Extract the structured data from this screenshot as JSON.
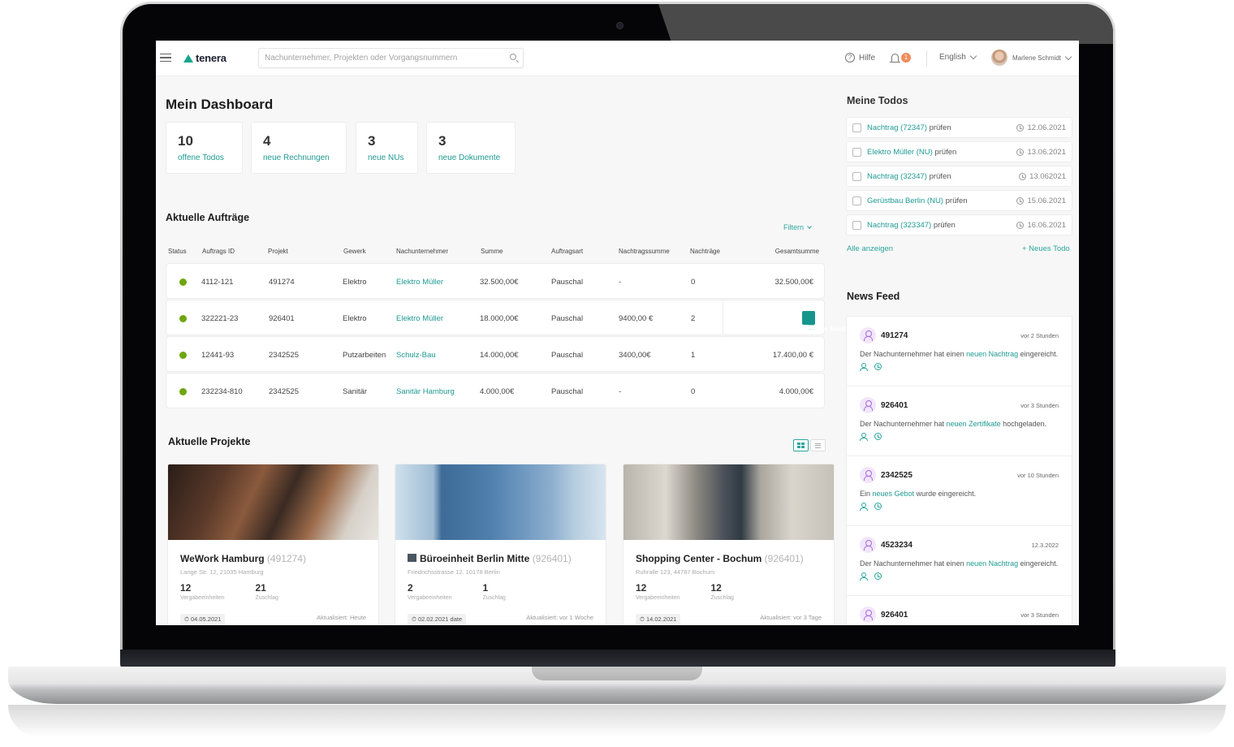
{
  "app": {
    "brand": "tenera",
    "accent_color": "#1f9a93",
    "status_color": "#6fa50f"
  },
  "topbar": {
    "search_placeholder": "Nachunternehmer, Projekten oder Vorgangsnummern",
    "help_label": "Hilfe",
    "notification_count": "1",
    "language": "English",
    "user_name": "Marlene Schmidt",
    "icons": [
      "menu-icon",
      "search-icon",
      "help-icon",
      "bell-icon",
      "chevron-down-icon",
      "avatar"
    ]
  },
  "dashboard": {
    "title": "Mein Dashboard",
    "stats": [
      {
        "value": "10",
        "label": "offene Todos"
      },
      {
        "value": "4",
        "label": "neue Rechnungen"
      },
      {
        "value": "3",
        "label": "neue NUs"
      },
      {
        "value": "3",
        "label": "neue Dokumente"
      }
    ]
  },
  "orders": {
    "title": "Aktuelle Aufträge",
    "filter_label": "Filtern",
    "columns": [
      "Status",
      "Auftrags ID",
      "Projekt",
      "Gewerk",
      "Nachunternehmer",
      "Summe",
      "Auftragsart",
      "Nachtragssumme",
      "Nachträge",
      "Gesamtsumme"
    ],
    "rows": [
      {
        "status": "active",
        "id": "4112-121",
        "projekt": "491274",
        "gewerk": "Elektro",
        "nu": "Elektro Müller",
        "summe": "32.500,00€",
        "art": "Pauschal",
        "nachtragssumme": "-",
        "nachtraege": "0",
        "gesamt": "32.500,00€"
      },
      {
        "status": "active",
        "id": "322221-23",
        "projekt": "926401",
        "gewerk": "Elektro",
        "nu": "Elektro Müller",
        "summe": "18.000,00€",
        "art": "Pauschal",
        "nachtragssumme": "9400,00 €",
        "nachtraege": "2",
        "gesamt": "",
        "action": "Neuer Nachtrag"
      },
      {
        "status": "active",
        "id": "12441-93",
        "projekt": "2342525",
        "gewerk": "Putzarbeiten",
        "nu": "Schulz-Bau",
        "summe": "14.000,00€",
        "art": "Pauschal",
        "nachtragssumme": "3400,00€",
        "nachtraege": "1",
        "gesamt": "17.400,00 €"
      },
      {
        "status": "active",
        "id": "232234-810",
        "projekt": "2342525",
        "gewerk": "Sanitär",
        "nu": "Sanitär Hamburg",
        "summe": "4.000,00€",
        "art": "Pauschal",
        "nachtragssumme": "-",
        "nachtraege": "0",
        "gesamt": "4.000,00€"
      }
    ]
  },
  "projects": {
    "title": "Aktuelle Projekte",
    "view_mode": "grid",
    "items": [
      {
        "name": "WeWork Hamburg",
        "id": "(491274)",
        "address": "Lange Str. 12, 21035 Hamburg",
        "vergabe": "12",
        "vergabe_label": "Vergabeeinheiten",
        "zuschlag": "21",
        "zuschlag_label": "Zuschlag",
        "date": "04.05.2021",
        "updated": "Aktualisiert: Heute"
      },
      {
        "name": "Büroeinheit Berlin Mitte",
        "id": "(926401)",
        "address": "Friedrichsstrasse 12. 10178 Berlin",
        "vergabe": "2",
        "vergabe_label": "Vergabeeinheiten",
        "zuschlag": "1",
        "zuschlag_label": "Zuschlag",
        "date": "02.02.2021 date",
        "updated": "Aktualisiert: vor 1 Woche"
      },
      {
        "name": "Shopping Center - Bochum",
        "id": "(926401)",
        "address": "Ruhralle 123,  44787 Bochum",
        "vergabe": "12",
        "vergabe_label": "Vergabeeinheiten",
        "zuschlag": "12",
        "zuschlag_label": "Zuschlag",
        "date": "14.02.2021",
        "updated": "Aktualisiert: vor 3 Tage"
      }
    ]
  },
  "todos": {
    "title": "Meine Todos",
    "items": [
      {
        "link": "Nachtrag (72347)",
        "suffix": " prüfen",
        "date": "12.06.2021"
      },
      {
        "link": "Elektro Müller (NU)",
        "suffix": " prüfen",
        "date": "13.06.2021"
      },
      {
        "link": "Nachtrag (32347)",
        "suffix": " prüfen",
        "date": "13.062021"
      },
      {
        "link": "Gerüstbau Berlin (NU)",
        "suffix": " prüfen",
        "date": "15.06.2021"
      },
      {
        "link": "Nachtrag (323347)",
        "suffix": " prüfen",
        "date": "16.06.2021"
      }
    ],
    "show_all": "Alle anzeigen",
    "new_todo": "+ Neues Todo"
  },
  "news": {
    "title": "News Feed",
    "items": [
      {
        "id": "491274",
        "time": "vor 2 Stunden",
        "pre": "Der Nachunternehmer hat einen ",
        "link": "neuen Nachtrag",
        "post": " eingereicht."
      },
      {
        "id": "926401",
        "time": "vor 3 Stunden",
        "pre": "Der Nachunternehmer hat ",
        "link": "neuen Zertifikate",
        "post": " hochgeladen."
      },
      {
        "id": "2342525",
        "time": "vor 10 Stunden",
        "pre": "Ein ",
        "link": "neues Gebot",
        "post": " wurde eingereicht."
      },
      {
        "id": "4523234",
        "time": "12.3.2022",
        "pre": "Der Nachunternehmer hat einen ",
        "link": "neuen Nachtrag",
        "post": " eingereicht."
      },
      {
        "id": "926401",
        "time": "vor 3 Stunden",
        "pre": "",
        "link": "",
        "post": ""
      }
    ]
  }
}
